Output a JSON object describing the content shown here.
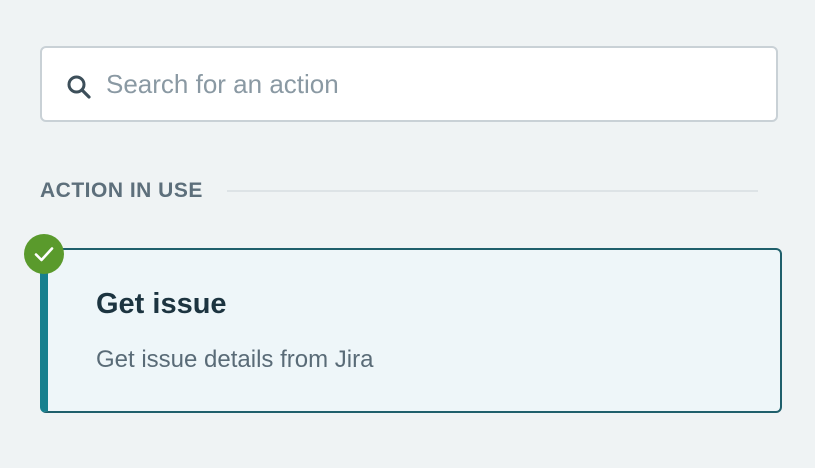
{
  "search": {
    "placeholder": "Search for an action",
    "value": "",
    "icon": "search-icon"
  },
  "section": {
    "title": "ACTION IN USE"
  },
  "action_card": {
    "title": "Get issue",
    "description": "Get issue details from Jira",
    "status_icon": "check-icon",
    "status_color": "#5a9a2c",
    "accent_color": "#17808e"
  }
}
